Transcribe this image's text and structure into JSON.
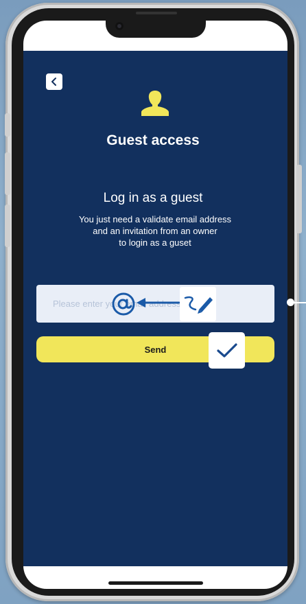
{
  "app": {
    "background_color": "#12305e",
    "accent_color": "#f1e65a"
  },
  "header": {
    "back_icon": "chevron-left-icon",
    "user_icon": "user-silhouette-icon",
    "title": "Guest access"
  },
  "main": {
    "subtitle": "Log in as a guest",
    "description_lines": [
      "You just need a validate email address",
      "and an invitation from an owner",
      "to login as a guset"
    ],
    "email_field": {
      "value": "",
      "placeholder": "Please enter your email address"
    },
    "send_label": "Send"
  },
  "annotations": {
    "at_icon": "at-sign-icon",
    "arrow_icon": "arrow-left-icon",
    "pen_icon": "pen-signature-icon",
    "check_icon": "checkmark-icon"
  }
}
